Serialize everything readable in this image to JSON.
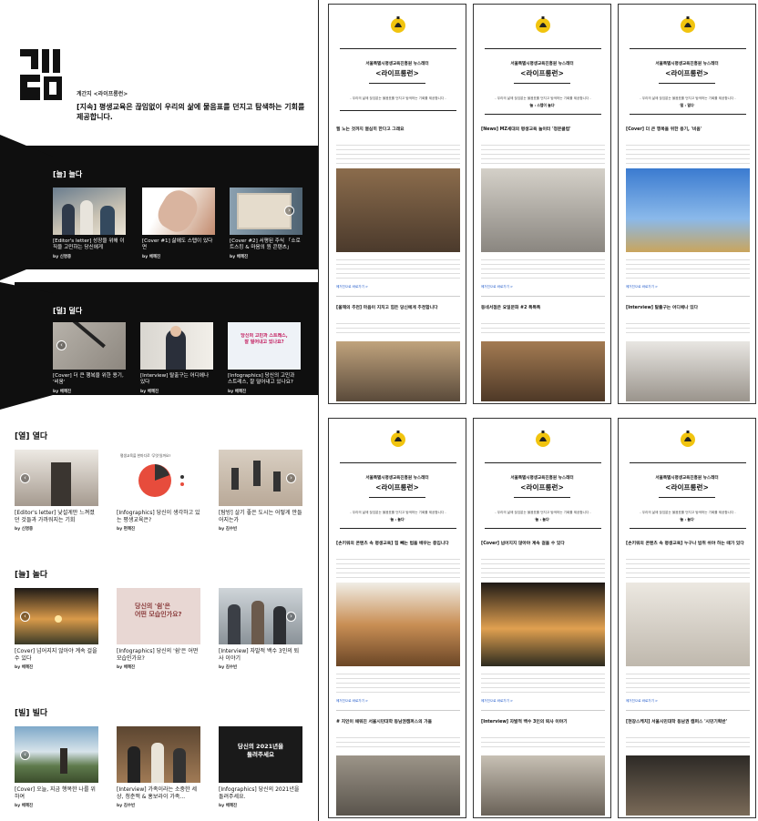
{
  "magazine": {
    "name": "계간지 <라이프롱런>",
    "tagline": "[지속] 평생교육은 끊임없이 우리의 삶에 물음표를 던지고 탐색하는 기회를 제공합니다."
  },
  "bands": [
    {
      "title": "[늘] 늘다",
      "cards": [
        {
          "title": "[Editor's letter] 성장을 위해 이직을 고민하는 당신에게",
          "by": "by 신명중"
        },
        {
          "title": "[Cover #1] 삶에도 스텝이 있다면",
          "by": "by 배혜진"
        },
        {
          "title": "[Cover #2] 서평된 주식 「소로 트스킹 & 마음의 원 콘텐츠」",
          "by": "by 배혜진"
        }
      ]
    },
    {
      "title": "[덜] 덜다",
      "cards": [
        {
          "title": "[Cover] 더 큰 행복을 위한 용기, '비움'",
          "by": "by 배혜진"
        },
        {
          "title": "[Interview] 탈출구는 어디에나 있다",
          "by": "by 배혜진"
        },
        {
          "title": "[Infographics] 당신의 고민과 스트레스, 잘 덜어내고 있나요?",
          "by": "by 배혜진"
        }
      ]
    }
  ],
  "sections": [
    {
      "title": "[열] 열다",
      "cards": [
        {
          "title": "[Editor's letter] 낯설게만 느껴졌던 것들과 가까워지는 기회",
          "by": "by 신명중"
        },
        {
          "title": "[Infographics] 당신이 생각하고 있는 평생교육은?",
          "by": "by 편혜진"
        },
        {
          "title": "[탐방] 살기 좋은 도시는 어떻게 만들어지는가",
          "by": "by 김수빈"
        }
      ]
    },
    {
      "title": "[늘] 놀다",
      "cards": [
        {
          "title": "[Cover] 넘어지지 않아야 계속 걸을 수 있다",
          "by": "by 배혜진"
        },
        {
          "title": "[Infographics] 당신의 '쉼'은 어떤 모습인가요?",
          "by": "by 배혜진"
        },
        {
          "title": "[Interview] 자발적 백수 3인의 퇴사 이야기",
          "by": "by 김수빈"
        }
      ]
    },
    {
      "title": "[빌] 빌다",
      "cards": [
        {
          "title": "[Cover] 오늘, 지금 행복한 나를 위하여",
          "by": "by 배혜진"
        },
        {
          "title": "[Interview] 가족이라는 소중한 세상, 청춘맥 & 홍보라이 가족...",
          "by": "by 김수빈"
        },
        {
          "title": "[Infographics] 당신의 2021년을 돌려주세요.",
          "by": "by 배혜진"
        }
      ]
    }
  ],
  "thumb_texts": {
    "info1": "평생교육을 한마디로 '무엇'일까요?",
    "rest1": "당신의 '쉼'은",
    "rest2": "어떤 모습인가요?",
    "year1": "당신의 2021년을",
    "year2": "돌려주세요",
    "stress1": "당신의 고민과 스트레스,",
    "stress2": "잘 덜어내고 있나요?"
  },
  "newsletters": [
    {
      "pub": "서울특별시평생교육진흥원 뉴스레터",
      "name": "<라이프롱런>",
      "desc": "- 우리의 삶에 끊임없는 물음표를 던지고 탐색하는 기회를 제공합니다 -",
      "issue": "",
      "h1": "필 노는 것까지 열심히 한다고 그래요",
      "h2": "[올해의 추천] 마음이 지치고 힘든 당신에게 추천합니다",
      "more": "메거진으로 바로가기 >"
    },
    {
      "pub": "서울특별시평생교육진흥원 뉴스레터",
      "name": "<라이프롱런>",
      "desc": "- 우리의 삶에 끊임없는 물음표를 던지고 탐색하는 기회를 제공합니다 -",
      "issue": "'늘 : 스텝이 늘다'",
      "h1": "[News] MZ세대의 평생교육 놀이터 '청문클럽'",
      "h2": "동네서점은 요일문화 #2 특특특",
      "more": "메거진으로 바로가기 >"
    },
    {
      "pub": "서울특별시평생교육진흥원 뉴스레터",
      "name": "<라이프롱런>",
      "desc": "- 우리의 삶에 끊임없는 물음표를 던지고 탐색하는 기회를 제공합니다 -",
      "issue": "'덜 : 덜다'",
      "h1": "[Cover] 더 큰 행복을 위한 용기, '비움'",
      "h2": "[Interview] 탈출구는 어디에나 있다",
      "more": "메거진으로 바로가기 >"
    },
    {
      "pub": "서울특별시평생교육진흥원 뉴스레터",
      "name": "<라이프롱런>",
      "desc": "- 우리의 삶에 끊임없는 물음표를 던지고 탐색하는 기회를 제공합니다 -",
      "issue": "'늘 : 놀다'",
      "h1": "[손키워의 콘텐츠 속 평생교육] 힘 빼는 법을 배우는 중입니다",
      "h2": "# 지인이 채워진 서울시민대학 동남권캠퍼스의 가을",
      "more": "메거진으로 바로가기 >"
    },
    {
      "pub": "서울특별시평생교육진흥원 뉴스레터",
      "name": "<라이프롱런>",
      "desc": "- 우리의 삶에 끊임없는 물음표를 던지고 탐색하는 기회를 제공합니다 -",
      "issue": "'늘 : 놀다'",
      "h1": "[Cover] 넘어지지 않아야 계속 걸을 수 있다",
      "h2": "[Interview] 자발적 백수 3인의 퇴사 이야기",
      "more": "메거진으로 바로가기 >"
    },
    {
      "pub": "서울특별시평생교육진흥원 뉴스레터",
      "name": "<라이프롱런>",
      "desc": "- 우리의 삶에 끊임없는 물음표를 던지고 탐색하는 기회를 제공합니다 -",
      "issue": "'늘 : 놀다'",
      "h1": "[손키워의 콘텐츠 속 평생교육] 누구나 빔취 쉬야 하는 때가 있다",
      "h2": "[현장스케치] 서울시민대학 동남권 캠퍼스 '시민기획반'",
      "more": "메거진으로 바로가기 >"
    }
  ]
}
